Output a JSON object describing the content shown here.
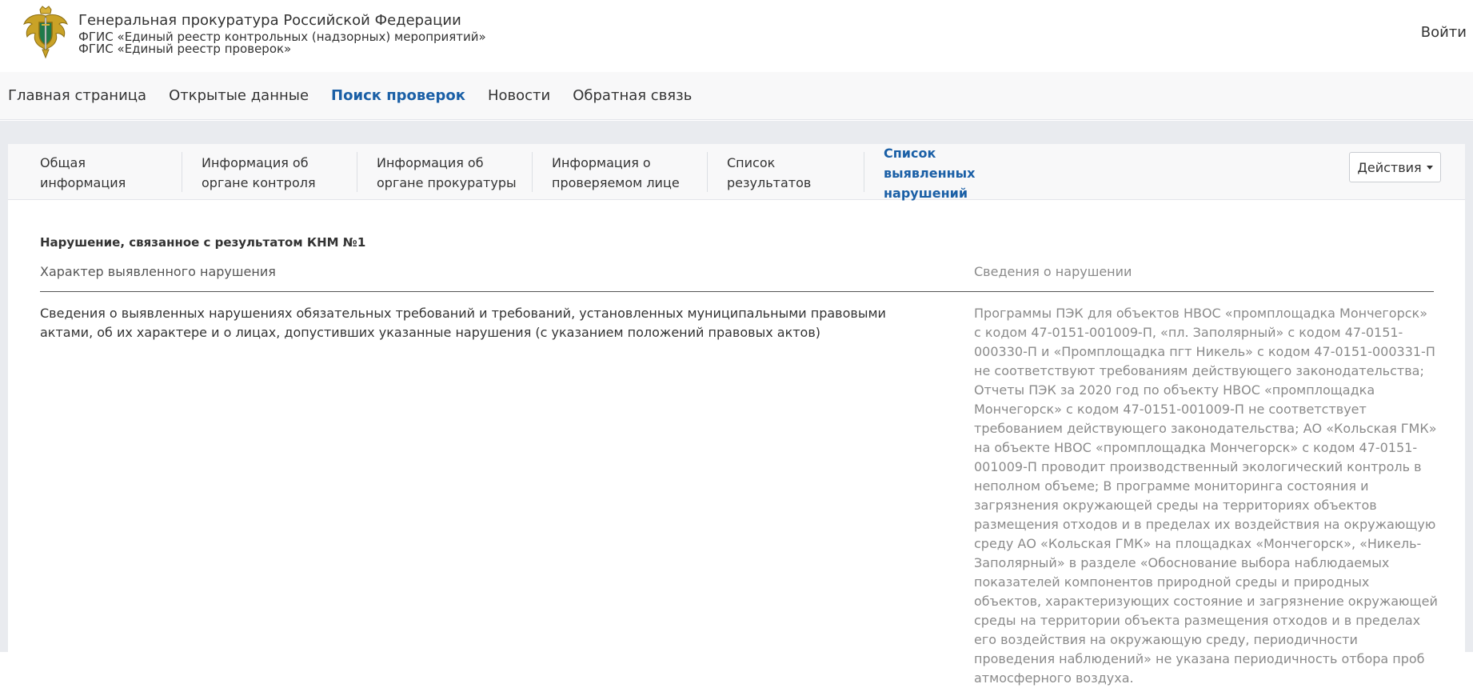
{
  "header": {
    "org_title": "Генеральная прокуратура Российской Федерации",
    "system_line1": "ФГИС «Единый реестр контрольных (надзорных) мероприятий»",
    "system_line2": "ФГИС «Единый реестр проверок»",
    "login_label": "Войти"
  },
  "nav": {
    "items": [
      {
        "label": "Главная страница"
      },
      {
        "label": "Открытые данные"
      },
      {
        "label": "Поиск проверок"
      },
      {
        "label": "Новости"
      },
      {
        "label": "Обратная связь"
      }
    ],
    "active_index": 2
  },
  "tabs": {
    "items": [
      {
        "label": "Общая информация"
      },
      {
        "label": "Информация об органе контроля"
      },
      {
        "label": "Информация об органе прокуратуры"
      },
      {
        "label": "Информация о проверяемом лице"
      },
      {
        "label": "Список результатов"
      },
      {
        "label": "Список выявленных нарушений"
      }
    ],
    "active_index": 5,
    "actions_label": "Действия"
  },
  "violation": {
    "section_title": "Нарушение, связанное с результатом КНМ №1",
    "col_character": "Характер выявленного нарушения",
    "col_details": "Сведения о нарушении",
    "row_label": "Сведения о выявленных нарушениях обязательных требований и требований, установленных муниципальными правовыми актами, об их характере и о лицах, допустивших указанные нарушения (с указанием положений правовых актов)",
    "row_value": "Программы ПЭК для объектов НВОС «промплощадка Мончегорск» с кодом 47-0151-001009-П, «пл. Заполярный» с кодом 47-0151-000330-П и «Промплощадка пгт Никель» с кодом 47-0151-000331-П не соответствуют требованиям действующего законодательства; Отчеты ПЭК за 2020 год по объекту НВОС «промплощадка Мончегорск» с кодом 47-0151-001009-П не соответствует требованием действующего законодательства; АО «Кольская ГМК» на объекте НВОС «промплощадка Мончегорск» с кодом 47-0151-001009-П проводит производственный экологический контроль в неполном объеме; В программе мониторинга состояния и загрязнения окружающей среды на территориях объектов размещения отходов и в пределах их воздействия на окружающую среду АО «Кольская ГМК» на площадках «Мончегорск», «Никель-Заполярный» в разделе «Обоснование выбора наблюдаемых показателей компонентов природной среды и природных объектов, характеризующих состояние и загрязнение окружающей среды на территории объекта размещения отходов и в пределах его воздействия на окружающую среду, периодичности проведения наблюдений» не указана периодичность отбора проб атмосферного воздуха."
  },
  "colors": {
    "accent": "#1a5fa6",
    "nav_bg": "#f8f8f9",
    "page_bg": "#e9ebef",
    "muted_text": "#8a8a8a"
  }
}
